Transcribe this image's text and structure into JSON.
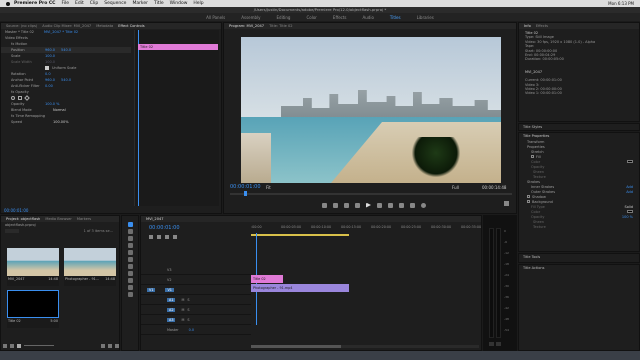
{
  "menubar": {
    "apple": "",
    "app": "Premiere Pro CC",
    "items": [
      "File",
      "Edit",
      "Clip",
      "Sequence",
      "Marker",
      "Title",
      "Window",
      "Help"
    ],
    "clock": "Mon 6:13 PM"
  },
  "titlebar": {
    "path": "/Users/Justin/Documents/adobe/Premiere Pro/12.0/objectflash.prproj *"
  },
  "workspaces": {
    "items": [
      "All Panels",
      "Assembly",
      "Editing",
      "Color",
      "Effects",
      "Audio",
      "Titles",
      "Libraries"
    ],
    "active": "Titles"
  },
  "effect_controls": {
    "tabs": [
      "Source: (no clips)",
      "Audio Clip Mixer: MVI_2047",
      "Metadata",
      "Effect Controls"
    ],
    "active_tab": "Effect Controls",
    "master": "Master * Title 02",
    "clip": "MVI_2047 * Title 02",
    "section": "Video Effects",
    "rows": [
      {
        "label": "fx Motion",
        "v1": "",
        "v2": ""
      },
      {
        "label": "Position",
        "v1": "960.0",
        "v2": "540.0"
      },
      {
        "label": "Scale",
        "v1": "100.0",
        "v2": ""
      },
      {
        "label": "Scale Width",
        "v1": "100.0",
        "v2": ""
      },
      {
        "label": "",
        "v1": "Uniform Scale",
        "v2": ""
      },
      {
        "label": "Rotation",
        "v1": "0.0",
        "v2": ""
      },
      {
        "label": "Anchor Point",
        "v1": "960.0",
        "v2": "540.0"
      },
      {
        "label": "Anti-flicker Filter",
        "v1": "0.00",
        "v2": ""
      },
      {
        "label": "fx Opacity",
        "v1": "",
        "v2": ""
      },
      {
        "label": "Opacity",
        "v1": "100.0 %",
        "v2": ""
      },
      {
        "label": "Blend Mode",
        "v1": "Normal",
        "v2": ""
      },
      {
        "label": "fx Time Remapping",
        "v1": "",
        "v2": ""
      },
      {
        "label": "Speed",
        "v1": "100.00%",
        "v2": ""
      }
    ],
    "mini_clip": "Title 02",
    "timecode": "00:00:01:00"
  },
  "program": {
    "tabs": [
      "Program: MVI_2047",
      "Title: Title 02"
    ],
    "active_tab": "Program: MVI_2047",
    "timecode": "00:00:01:00",
    "fit": "Fit",
    "quality": "Full",
    "duration": "00:00:14:48"
  },
  "info": {
    "tabs": [
      "Info",
      "Effects"
    ],
    "active_tab": "Info",
    "title_name": "Title 02",
    "type": "Type: Still Image",
    "video": "Video: 30 fps, 1920 x 1080 (1.0) - Alpha",
    "tape": "Tape:",
    "start": "Start: 00:00:00:00",
    "end": "End: 00:00:04:29",
    "dur": "Duration: 00:00:05:00",
    "clip_name": "MVI_2047",
    "current": "Current: 00:00:01:00",
    "video1": "Video 3:",
    "video2": "Video 2: 00:00:00:00",
    "video3": "Video 1: 00:00:01:00"
  },
  "title_styles": {
    "header": "Title Styles"
  },
  "title_props": {
    "header": "Title Properties",
    "rows": [
      {
        "label": "Transform",
        "v": ""
      },
      {
        "label": "Properties",
        "v": ""
      },
      {
        "label": "Stretch",
        "v": ""
      },
      {
        "label": "Fill",
        "v": ""
      },
      {
        "label": "Color",
        "v": ""
      },
      {
        "label": "Opacity",
        "v": ""
      },
      {
        "label": "Sheen",
        "v": ""
      },
      {
        "label": "Texture",
        "v": ""
      },
      {
        "label": "Strokes",
        "v": ""
      },
      {
        "label": "Inner Strokes",
        "v": "Add"
      },
      {
        "label": "Outer Strokes",
        "v": "Add"
      },
      {
        "label": "Shadow",
        "v": ""
      },
      {
        "label": "Background",
        "v": ""
      },
      {
        "label": "Fill Type",
        "v": "Solid"
      },
      {
        "label": "Color",
        "v": ""
      },
      {
        "label": "Opacity",
        "v": "100 %"
      },
      {
        "label": "Sheen",
        "v": ""
      },
      {
        "label": "Texture",
        "v": ""
      }
    ],
    "tools": "Title Tools",
    "actions": "Title Actions"
  },
  "project": {
    "tabs": [
      "Project: objectflash",
      "Media Browser",
      "Markers"
    ],
    "active_tab": "Project: objectflash",
    "file": "objectflash.prproj",
    "count": "1 of 3 items se...",
    "items": [
      {
        "name": "MVI_2047",
        "dur": "14:48",
        "kind": "beach"
      },
      {
        "name": "Photographer - 91...",
        "dur": "14:48",
        "kind": "beach"
      },
      {
        "name": "Title 02",
        "dur": "5:00",
        "kind": "black"
      }
    ]
  },
  "timeline": {
    "tab": "MVI_2047",
    "timecode": "00:00:01:00",
    "ruler": [
      ":00:00",
      "00:00:05:00",
      "00:00:10:00",
      "00:00:15:00",
      "00:00:20:00",
      "00:00:25:00",
      "00:00:30:00",
      "00:00:35:00"
    ],
    "tracks": [
      "V3",
      "V2",
      "V1",
      "A1",
      "A2",
      "A3",
      "Master"
    ],
    "master_val": "0.0",
    "clip_title": "Title 02",
    "clip_video": "Photographer - 91.mp4"
  },
  "meter_scale": [
    "0",
    "-6",
    "-12",
    "-18",
    "-24",
    "-30",
    "-36",
    "-42",
    "-48",
    "-54"
  ],
  "colors": {
    "accent": "#3a8ff0",
    "title_clip": "#e07ad6",
    "video_clip": "#9a86dc"
  }
}
